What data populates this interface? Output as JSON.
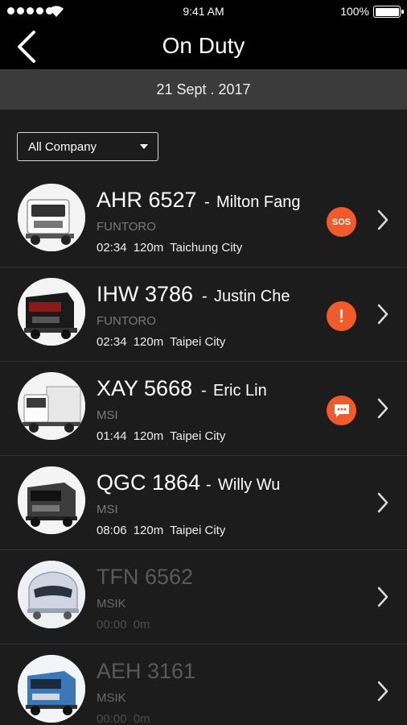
{
  "status_bar": {
    "time": "9:41 AM",
    "battery": "100%"
  },
  "nav": {
    "title": "On Duty"
  },
  "date": "21 Sept . 2017",
  "filter": {
    "selected": "All Company"
  },
  "colors": {
    "alert": "#f15a29",
    "background": "#1c1c1c",
    "date_bar": "#3b3b3b"
  },
  "vehicles": [
    {
      "plate": "AHR 6527",
      "driver": "Milton Fang",
      "company": "FUNTORO",
      "time": "02:34",
      "distance": "120m",
      "location": "Taichung City",
      "status_icon": "sos-icon",
      "status_text": "SOS",
      "online": true
    },
    {
      "plate": "IHW 3786",
      "driver": "Justin Che",
      "company": "FUNTORO",
      "time": "02:34",
      "distance": "120m",
      "location": "Taipei City",
      "status_icon": "alert-icon",
      "status_text": "!",
      "online": true
    },
    {
      "plate": "XAY 5668",
      "driver": "Eric Lin",
      "company": "MSI",
      "time": "01:44",
      "distance": "120m",
      "location": "Taipei City",
      "status_icon": "message-icon",
      "online": true
    },
    {
      "plate": "QGC 1864",
      "driver": "Willy Wu",
      "company": "MSI",
      "time": "08:06",
      "distance": "120m",
      "location": "Taipei City",
      "online": true
    },
    {
      "plate": "TFN 6562",
      "driver": "",
      "company": "MSIK",
      "time": "00:00",
      "distance": "0m",
      "location": "",
      "online": false
    },
    {
      "plate": "AEH 3161",
      "driver": "",
      "company": "MSIK",
      "time": "00:00",
      "distance": "0m",
      "location": "",
      "online": false
    }
  ]
}
